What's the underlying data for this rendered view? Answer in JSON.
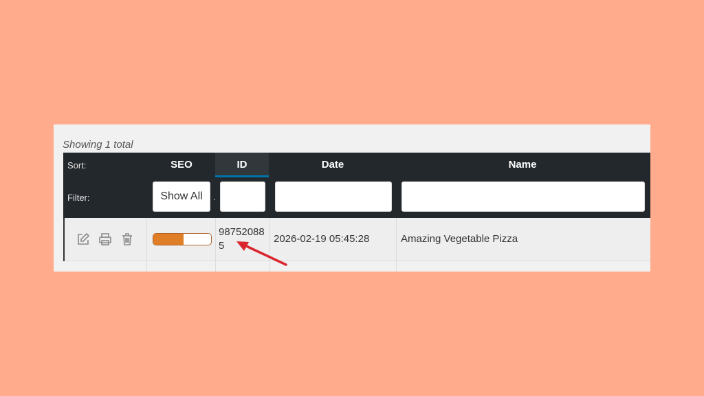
{
  "summary": "Showing 1 total",
  "header": {
    "sort_label": "Sort:",
    "filter_label": "Filter:",
    "columns": {
      "seo": "SEO",
      "id": "ID",
      "date": "Date",
      "name": "Name"
    },
    "seo_filter_value": "Show All",
    "active_sort": "ID"
  },
  "row": {
    "id": "987520885",
    "date": "2026-02-19 05:45:28",
    "name": "Amazing Vegetable Pizza",
    "seo_score_fraction": 0.52
  },
  "icons": [
    "edit-icon",
    "print-icon",
    "trash-icon"
  ],
  "colors": {
    "background": "#ffab8c",
    "header": "#23282d",
    "active_underline": "#0073aa",
    "seo_fill": "#e07e27",
    "annotation_arrow": "#d9262c"
  }
}
